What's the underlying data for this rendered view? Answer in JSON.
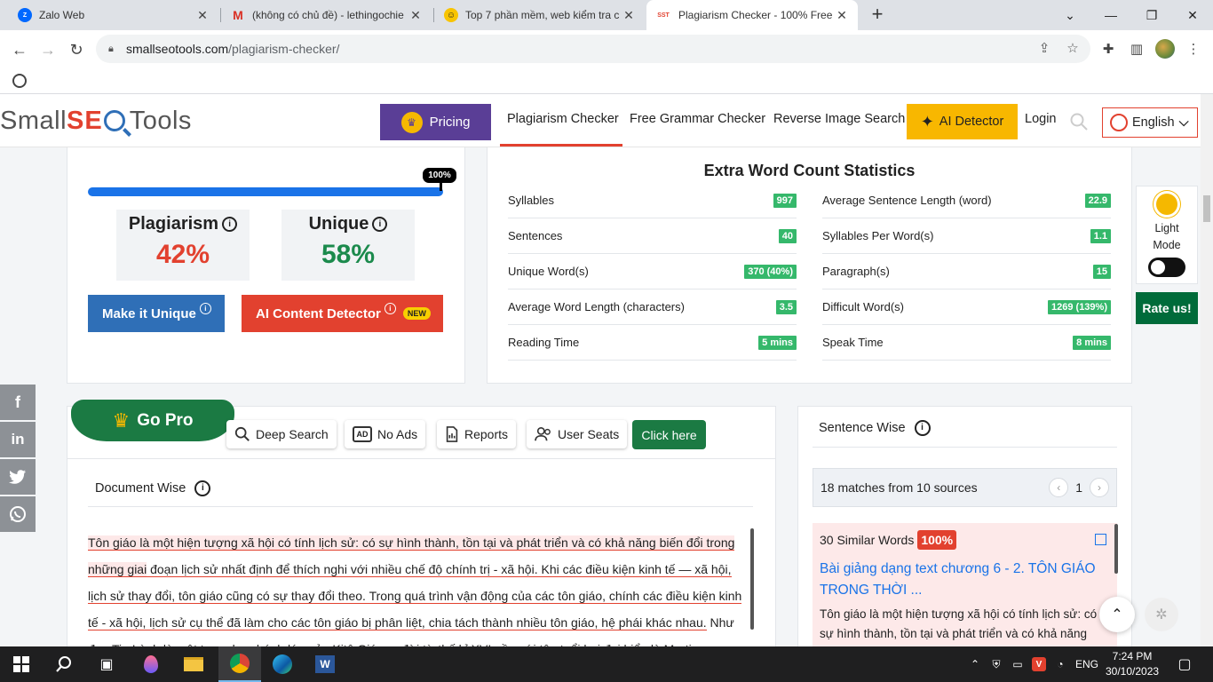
{
  "browser": {
    "tabs": [
      {
        "title": "Zalo Web",
        "icon": "zalo-icon"
      },
      {
        "title": "(không có chủ đề) - lethingochie",
        "icon": "gmail-icon"
      },
      {
        "title": "Top 7 phần mềm, web kiểm tra c",
        "icon": "emoji-icon"
      },
      {
        "title": "Plagiarism Checker - 100% Free",
        "icon": "sst-icon",
        "favicon_text": "SST"
      }
    ],
    "url_host": "smallseotools.com",
    "url_path": "/plagiarism-checker/"
  },
  "header": {
    "logo_small": "Small",
    "logo_seo": "SE",
    "logo_tools": "Tools",
    "pricing": "Pricing",
    "nav": [
      "Plagiarism Checker",
      "Free Grammar Checker",
      "Reverse Image Search"
    ],
    "ai_detector": "AI Detector",
    "login": "Login",
    "language": "English"
  },
  "result": {
    "progress_label": "100%",
    "progress": 1.0,
    "plagiarism_label": "Plagiarism",
    "plagiarism_value": "42%",
    "unique_label": "Unique",
    "unique_value": "58%",
    "make_unique": "Make it Unique",
    "ai_content": "AI Content Detector",
    "new_badge": "NEW"
  },
  "extra_stats": {
    "title": "Extra Word Count Statistics",
    "left": [
      {
        "label": "Syllables",
        "value": "997"
      },
      {
        "label": "Sentences",
        "value": "40"
      },
      {
        "label": "Unique Word(s)",
        "value": "370 (40%)"
      },
      {
        "label": "Average Word Length (characters)",
        "value": "3.5"
      },
      {
        "label": "Reading Time",
        "value": "5 mins"
      }
    ],
    "right": [
      {
        "label": "Average Sentence Length (word)",
        "value": "22.9"
      },
      {
        "label": "Syllables Per Word(s)",
        "value": "1.1"
      },
      {
        "label": "Paragraph(s)",
        "value": "15"
      },
      {
        "label": "Difficult Word(s)",
        "value": "1269 (139%)"
      },
      {
        "label": "Speak Time",
        "value": "8 mins"
      }
    ]
  },
  "side": {
    "light": "Light",
    "mode": "Mode",
    "rate": "Rate us!"
  },
  "social": [
    "f",
    "in",
    "tw",
    "wa"
  ],
  "gopro": {
    "title": "Go Pro",
    "chips": [
      "Deep Search",
      "No Ads",
      "Reports",
      "User Seats"
    ],
    "chip_ad_icon_text": "AD",
    "click_here": "Click here"
  },
  "document": {
    "title": "Document Wise",
    "segments": [
      "Tôn giáo là một hiện tượng xã hội có tính lịch sử: có sự hình thành, tồn tại và phát triển và có khả năng biến đổi trong những giai",
      " đoạn lịch sử nhất định để thích nghi với nhiều chế độ chính trị - xã hội.",
      " Khi các điều kiện kinh tế — xã hội, lịch sử thay đổi, tôn giáo cũng có sự thay đổi theo.",
      " Trong quá trình vận động của các tôn giáo, chính các điều kiện kinh tế - xã hội, lịch sử cụ thể đã làm cho các tôn giáo bị",
      " phân liệt, chia tách thành nhiều tôn giáo, hệ phái khác nhau.",
      " Như đạo Tin Lành là một trong ba nhánh lớn của Kitô Giáo ra đời từ thế kỉ XVI gần với tên tuổi hai đại biểu là Martin"
    ]
  },
  "sentence": {
    "title": "Sentence Wise",
    "matches": "18 matches from 10 sources",
    "page": "1",
    "similar": "30 Similar Words",
    "percent": "100%",
    "link": "Bài giảng dạng text chương 6 - 2. TÔN GIÁO TRONG THỜI ...",
    "snippet": "Tôn giáo là một hiện tượng xã hội có tính lịch sử: có sự hình thành, tồn tại và phát triển và có khả năng"
  },
  "taskbar": {
    "lang": "ENG",
    "time": "7:24 PM",
    "date": "30/10/2023",
    "word_icon_text": "W",
    "vivaldi_icon_text": "V"
  }
}
